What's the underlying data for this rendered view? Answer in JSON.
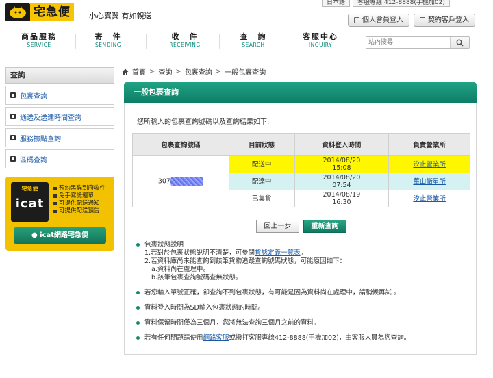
{
  "header": {
    "brand": "宅急便",
    "slogan": "小心翼翼 有如親送",
    "lang_label": "日本語",
    "service_phone": "客服專線:412-8888(手機加02)",
    "member_login": "個人會員登入",
    "corporate_login": "契約客戶登入"
  },
  "nav": [
    {
      "zh": "商品服務",
      "en": "SERVICE"
    },
    {
      "zh": "寄　件",
      "en": "SENDING"
    },
    {
      "zh": "收　件",
      "en": "RECEIVING"
    },
    {
      "zh": "查　詢",
      "en": "SEARCH"
    },
    {
      "zh": "客服中心",
      "en": "INQUIRY"
    }
  ],
  "search": {
    "placeholder": "站內搜尋"
  },
  "sidebar": {
    "title": "查詢",
    "items": [
      {
        "label": "包裹查詢"
      },
      {
        "label": "通送及送達時間查詢"
      },
      {
        "label": "服務據點查詢"
      },
      {
        "label": "區碼查詢"
      }
    ],
    "icat": {
      "box_top": "宅急便",
      "box_main": "icat",
      "features": [
        "預約黑貓到府收件",
        "免手寫託運單",
        "可提供配送通知",
        "可提供配送預告"
      ],
      "button": "icat網路宅急便"
    }
  },
  "breadcrumb": {
    "home": "首頁",
    "items": [
      "查詢",
      "包裹查詢",
      "一般包裹查詢"
    ]
  },
  "panel": {
    "title": "一般包裹查詢",
    "intro": "您所輸入的包裹查詢號碼以及查詢結果如下:",
    "table": {
      "headers": [
        "包裹查詢號碼",
        "目前狀態",
        "資料登入時間",
        "負責營業所"
      ],
      "tracking_prefix": "307",
      "rows": [
        {
          "status": "配送中",
          "date": "2014/08/20",
          "time": "15:08",
          "office": "汐止營業所"
        },
        {
          "status": "配達中",
          "date": "2014/08/20",
          "time": "07:54",
          "office": "華山衛星所"
        },
        {
          "status": "已集貨",
          "date": "2014/08/19",
          "time": "16:30",
          "office": "汐止營業所"
        }
      ]
    },
    "back_button": "回上一步",
    "requery_button": "重新查詢"
  },
  "notes": {
    "n1_title": "包裹狀態說明",
    "n1_line1_pre": "1.若對於包裹狀態說明不清楚，可參閱",
    "n1_line1_link": "貨態定義一覽表",
    "n1_line1_post": "。",
    "n1_line2": "2.若資料庫尚未能查詢到該筆貨物追蹤查詢號碼狀態，可能原因如下：",
    "n1_line2a": "a.資料尚在處理中。",
    "n1_line2b": "b.該筆包裹查詢號碼查無狀態。",
    "n2": "若您輸入單號正確，卻查詢不到包裹狀態，有可能是因為資料尚在處理中，請稍候再試 。",
    "n3": "資料登入時間為SD輸入包裹狀態的時間。",
    "n4": "資料保留時間僅為三個月，您將無法查詢三個月之前的資料。",
    "n5_pre": "若有任何問題請使用",
    "n5_link": "網路客服",
    "n5_post": "或撥打客服專線412-8888(手機加02)，由客服人員為您查詢。"
  }
}
